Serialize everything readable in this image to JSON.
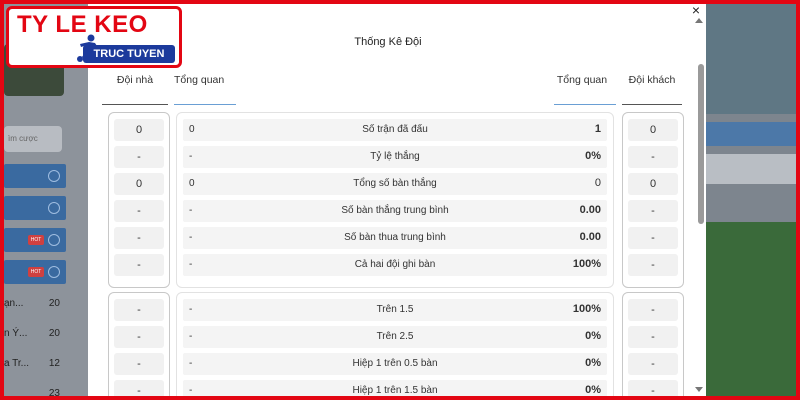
{
  "logo": {
    "main": "TY LE KEO",
    "sub": "TRUC TUYEN"
  },
  "background": {
    "search_placeholder": "ìm cược",
    "hot_badge": "HOT",
    "list": [
      {
        "label": "ạn...",
        "value": "20"
      },
      {
        "label": "n Ý...",
        "value": "20"
      },
      {
        "label": "a Tr...",
        "value": "12"
      },
      {
        "label": "",
        "value": "23"
      }
    ]
  },
  "modal": {
    "title": "Thống Kê Đội",
    "headers": {
      "home": "Đội nhà",
      "overview_left": "Tổng quan",
      "overview_right": "Tổng quan",
      "away": "Đội khách"
    },
    "section1": [
      {
        "home": "0",
        "left": "0",
        "label": "Số trận đã đấu",
        "right": "1",
        "away": "0",
        "right_light": false
      },
      {
        "home": "-",
        "left": "-",
        "label": "Tỷ lệ thắng",
        "right": "0%",
        "away": "-",
        "right_light": false
      },
      {
        "home": "0",
        "left": "0",
        "label": "Tổng số bàn thắng",
        "right": "0",
        "away": "0",
        "right_light": true
      },
      {
        "home": "-",
        "left": "-",
        "label": "Số bàn thắng trung bình",
        "right": "0.00",
        "away": "-",
        "right_light": false
      },
      {
        "home": "-",
        "left": "-",
        "label": "Số bàn thua trung bình",
        "right": "0.00",
        "away": "-",
        "right_light": false
      },
      {
        "home": "-",
        "left": "-",
        "label": "Cả hai đội ghi bàn",
        "right": "100%",
        "away": "-",
        "right_light": false
      }
    ],
    "section2": [
      {
        "home": "-",
        "left": "-",
        "label": "Trên 1.5",
        "right": "100%",
        "away": "-"
      },
      {
        "home": "-",
        "left": "-",
        "label": "Trên 2.5",
        "right": "0%",
        "away": "-"
      },
      {
        "home": "-",
        "left": "-",
        "label": "Hiệp 1 trên 0.5 bàn",
        "right": "0%",
        "away": "-"
      },
      {
        "home": "-",
        "left": "-",
        "label": "Hiệp 1 trên 1.5 bàn",
        "right": "0%",
        "away": "-"
      }
    ],
    "close_symbol": "×"
  },
  "colors": {
    "brand_red": "#e30613",
    "brand_blue": "#1c3a9c",
    "header_underline": "#6a9fd4"
  }
}
